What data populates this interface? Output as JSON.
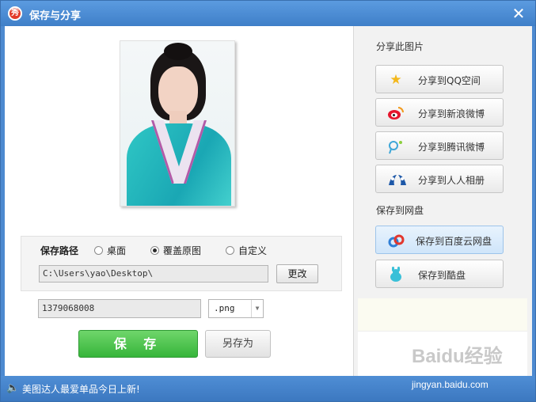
{
  "window": {
    "title": "保存与分享",
    "app_icon_text": "秀",
    "close_glyph": "✕"
  },
  "save_path": {
    "label": "保存路径",
    "options": [
      {
        "label": "桌面",
        "selected": false
      },
      {
        "label": "覆盖原图",
        "selected": true
      },
      {
        "label": "自定义",
        "selected": false
      }
    ],
    "path_value": "C:\\Users\\yao\\Desktop\\",
    "change_label": "更改"
  },
  "file": {
    "name_value": "1379068008",
    "format_value": ".png"
  },
  "actions": {
    "save_label": "保 存",
    "save_as_label": "另存为"
  },
  "share": {
    "section_title": "分享此图片",
    "buttons": [
      {
        "label": "分享到QQ空间",
        "icon": "star-icon"
      },
      {
        "label": "分享到新浪微博",
        "icon": "weibo-icon"
      },
      {
        "label": "分享到腾讯微博",
        "icon": "tencent-weibo-icon"
      },
      {
        "label": "分享到人人相册",
        "icon": "renren-icon"
      }
    ]
  },
  "cloud": {
    "section_title": "保存到网盘",
    "buttons": [
      {
        "label": "保存到百度云网盘",
        "icon": "baidu-cloud-icon",
        "highlighted": true
      },
      {
        "label": "保存到酷盘",
        "icon": "kupan-icon",
        "highlighted": false
      }
    ]
  },
  "statusbar": {
    "message": "美图达人最爱单品今日上新!"
  },
  "watermark": {
    "brand": "Baidu经验",
    "url": "jingyan.baidu.com"
  },
  "colors": {
    "save_green": "#36b53a",
    "title_blue": "#4d8ad0"
  }
}
